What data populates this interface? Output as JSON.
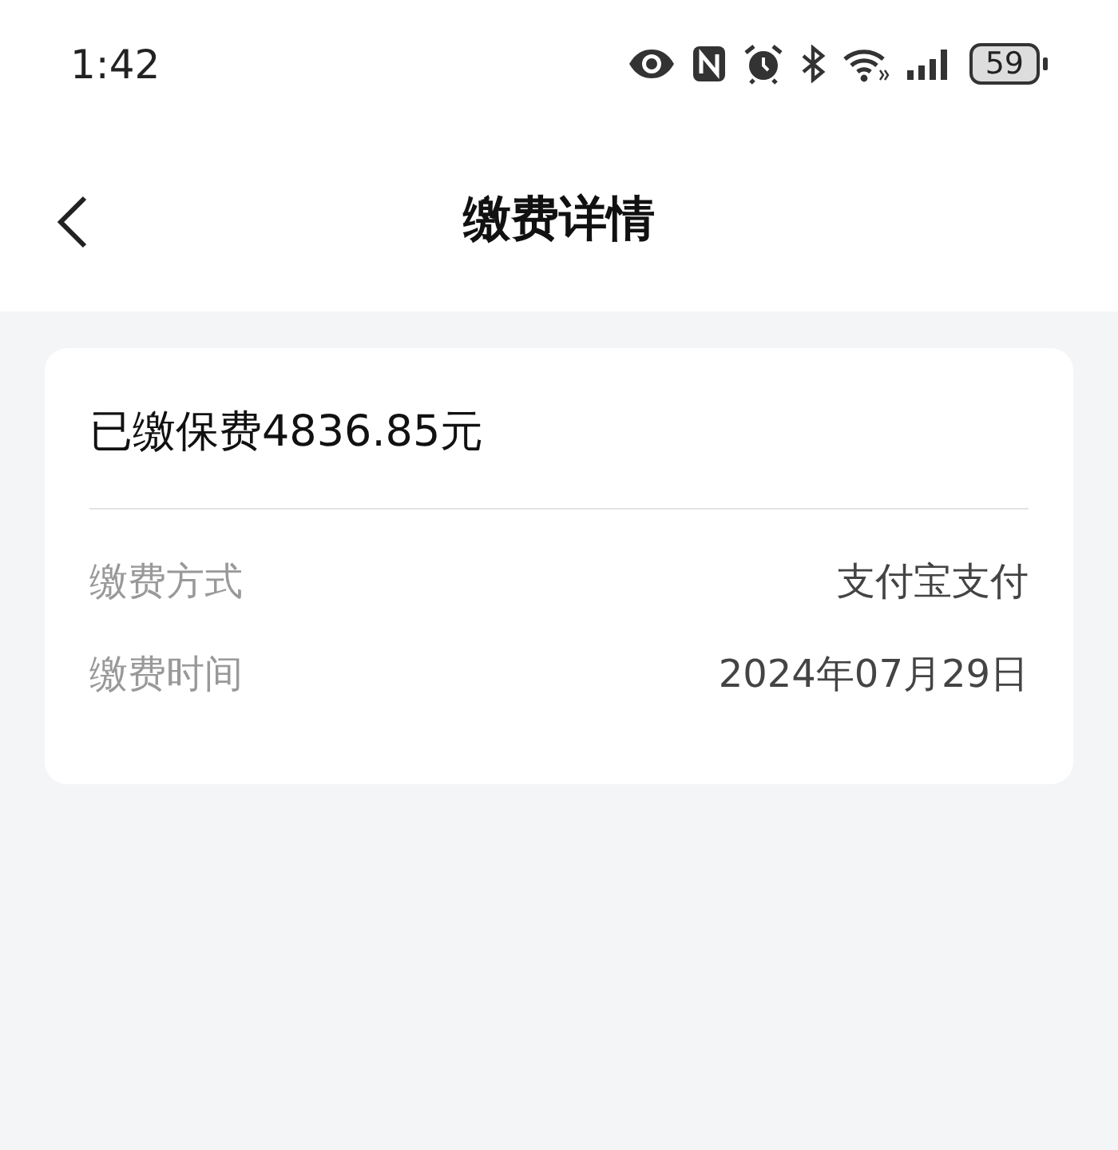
{
  "status_bar": {
    "time": "1:42",
    "battery": "59"
  },
  "header": {
    "title": "缴费详情"
  },
  "card": {
    "heading": "已缴保费4836.85元",
    "rows": [
      {
        "label": "缴费方式",
        "value": "支付宝支付"
      },
      {
        "label": "缴费时间",
        "value": "2024年07月29日"
      }
    ]
  }
}
